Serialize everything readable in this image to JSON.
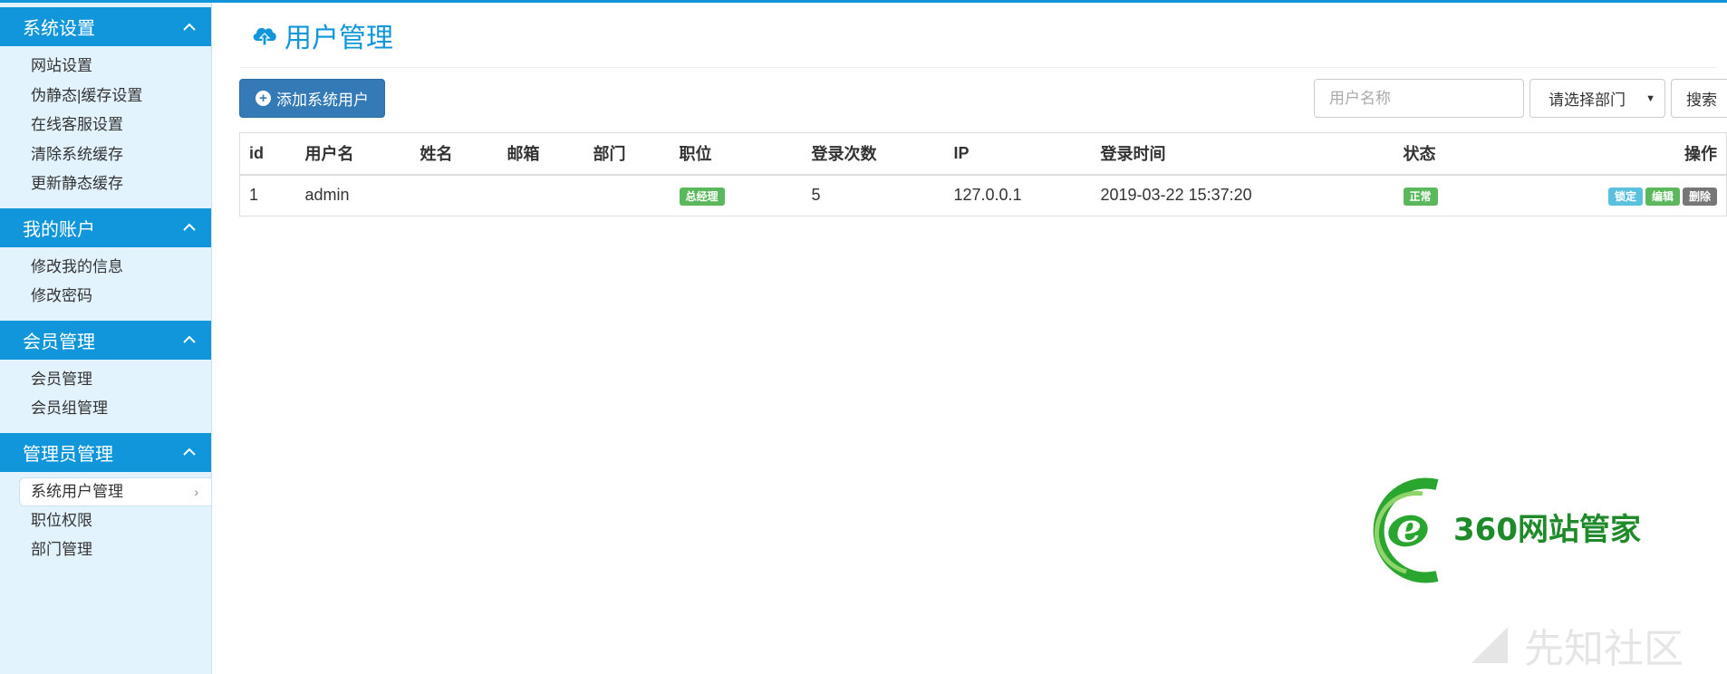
{
  "sidebar": {
    "sections": [
      {
        "title": "系统设置",
        "items": [
          "网站设置",
          "伪静态|缓存设置",
          "在线客服设置",
          "清除系统缓存",
          "更新静态缓存"
        ]
      },
      {
        "title": "我的账户",
        "items": [
          "修改我的信息",
          "修改密码"
        ]
      },
      {
        "title": "会员管理",
        "items": [
          "会员管理",
          "会员组管理"
        ]
      },
      {
        "title": "管理员管理",
        "items": [
          "系统用户管理",
          "职位权限",
          "部门管理"
        ],
        "active": "系统用户管理"
      }
    ]
  },
  "main": {
    "title": "用户管理",
    "add_button": "添加系统用户",
    "search": {
      "placeholder": "用户名称",
      "dept_select": "请选择部门",
      "search_button": "搜索"
    },
    "table": {
      "headers": [
        "id",
        "用户名",
        "姓名",
        "邮箱",
        "部门",
        "职位",
        "登录次数",
        "IP",
        "登录时间",
        "状态",
        "操作"
      ],
      "rows": [
        {
          "id": "1",
          "username": "admin",
          "name": "",
          "email": "",
          "dept": "",
          "position": "总经理",
          "logins": "5",
          "ip": "127.0.0.1",
          "login_time": "2019-03-22 15:37:20",
          "status": "正常",
          "actions": [
            "锁定",
            "编辑",
            "删除"
          ]
        }
      ]
    }
  },
  "logo": {
    "text": "360网站管家",
    "letter": "e"
  },
  "watermark": {
    "text": "先知社区"
  },
  "colors": {
    "accent": "#1296db",
    "sidebar_bg": "#e3f3fd",
    "primary": "#337ab7",
    "success": "#5cb85c",
    "info": "#5bc0de",
    "muted": "#777777"
  }
}
